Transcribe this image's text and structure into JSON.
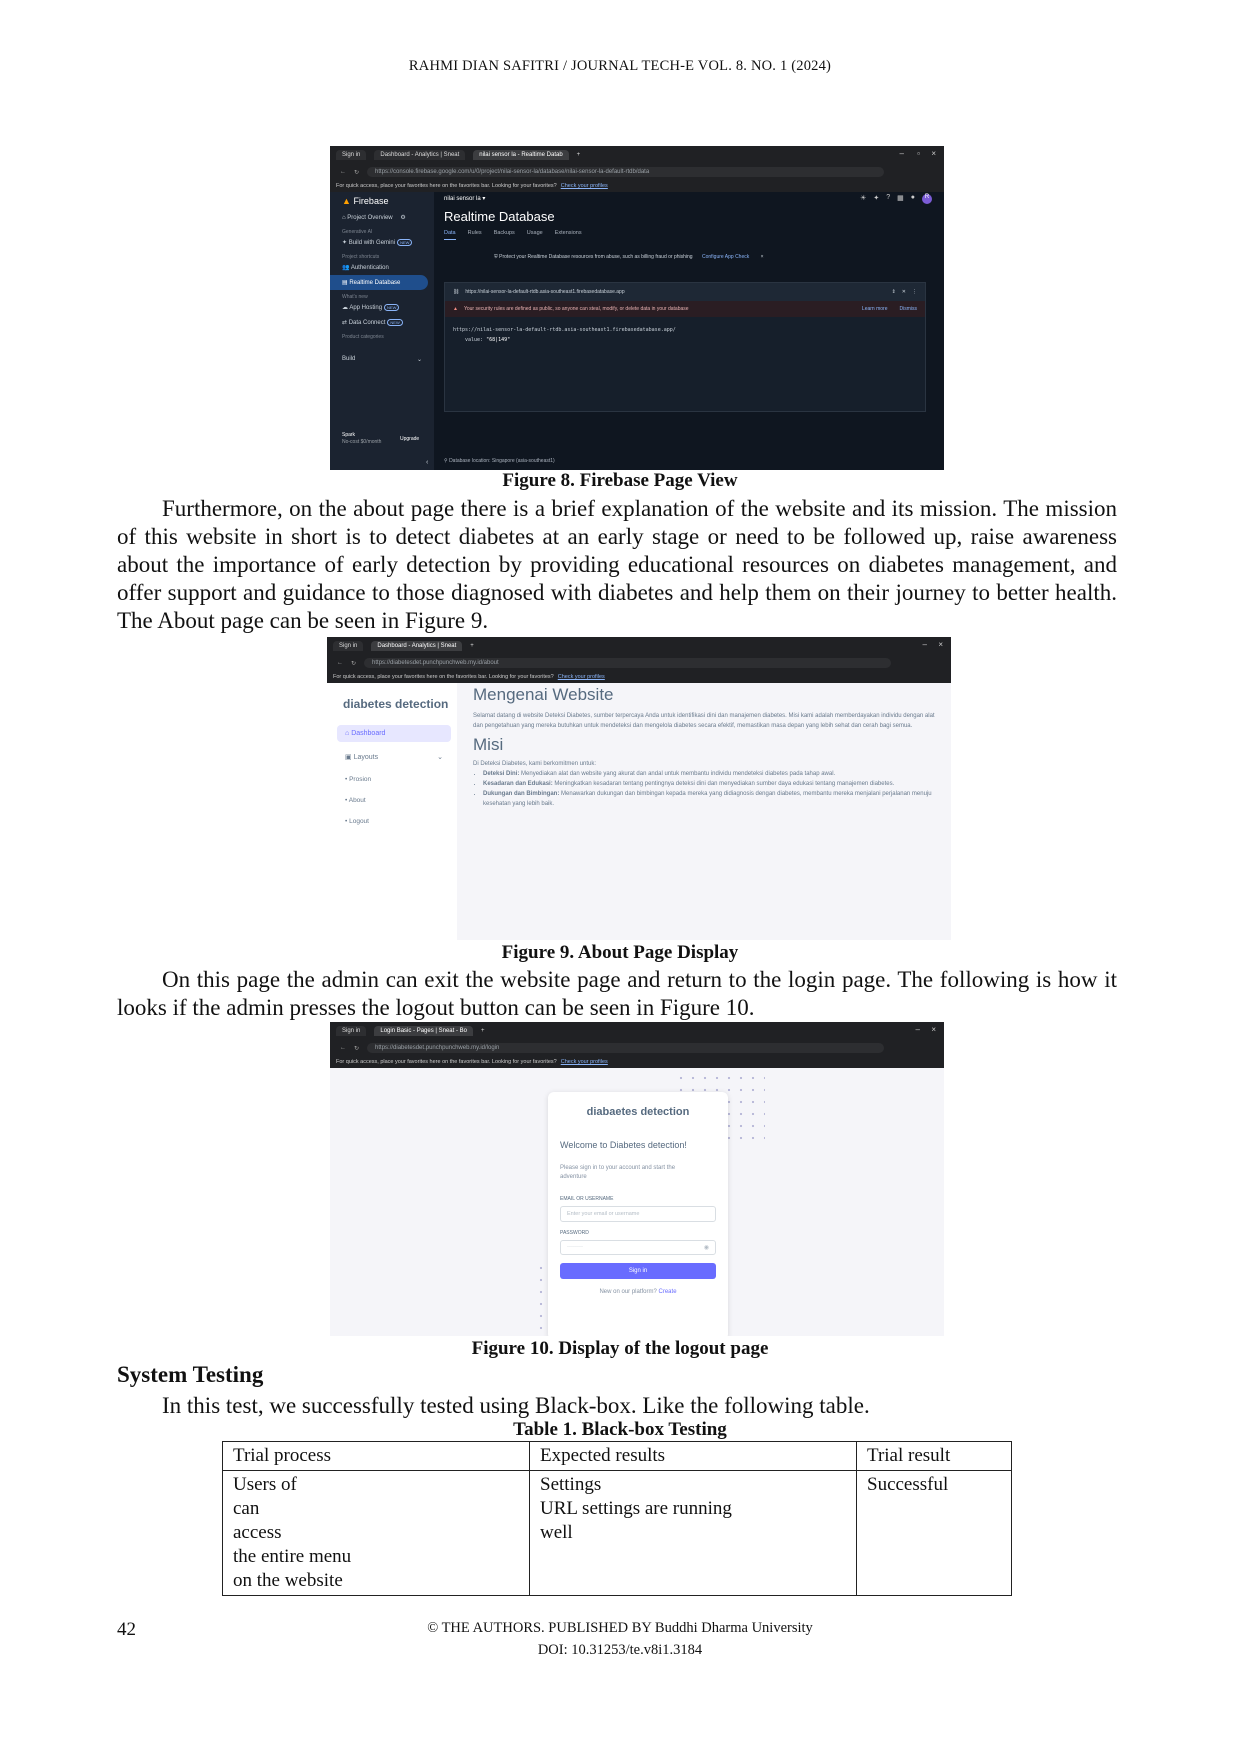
{
  "header": {
    "running_head": "RAHMI DIAN SAFITRI / JOURNAL TECH-E VOL. 8. NO. 1 (2024)"
  },
  "figure8": {
    "caption": "Figure 8. Firebase Page View",
    "tabs": [
      "Sign in",
      "Dashboard - Analytics | Sneat",
      "nilai sensor la - Realtime Datab"
    ],
    "url": "https://console.firebase.google.com/u/0/project/nilai-sensor-la/database/nilai-sensor-la-default-rtdb/data",
    "favbar_text": "For quick access, place your favorites here on the favorites bar. Looking for your favorites?",
    "favbar_link": "Check your profiles",
    "brand": "Firebase",
    "project": "nilai sensor la",
    "sidebar": {
      "overview": "Project Overview",
      "cat_genai": "Generative AI",
      "gemini": "Build with Gemini",
      "cat_shortcuts": "Project shortcuts",
      "auth": "Authentication",
      "rtdb": "Realtime Database",
      "cat_new": "What's new",
      "hosting": "App Hosting",
      "dataconnect": "Data Connect",
      "cat_product": "Product categories",
      "build": "Build",
      "plan": "Spark",
      "plan_sub": "No-cost $0/month",
      "upgrade": "Upgrade",
      "new_badge": "NEW"
    },
    "page_title": "Realtime Database",
    "tabs_main": [
      "Data",
      "Rules",
      "Backups",
      "Usage",
      "Extensions"
    ],
    "protect_text": "Protect your Realtime Database resources from abuse, such as billing fraud or phishing",
    "protect_link": "Configure App Check",
    "db_url": "https://nilai-sensor-la-default-rtdb.asia-southeast1.firebasedatabase.app",
    "warning": "Your security rules are defined as public, so anyone can steal, modify, or delete data in your database",
    "learn_more": "Learn more",
    "dismiss": "Dismiss",
    "tree_root": "https://nilai-sensor-la-default-rtdb.asia-southeast1.firebasedatabase.app/",
    "tree_key": "value:",
    "tree_value": "\"68|149\"",
    "location": "Database location: Singapore (asia-southeast1)"
  },
  "para1": "Furthermore, on the about page there is a brief explanation of the website and its mission. The mission of this website in short is to detect diabetes at an early stage or need to be followed up, raise awareness about the importance of early detection by providing educational resources on diabetes management, and offer support and guidance to those diagnosed with diabetes and help them on their journey to better health. The About page can be seen in Figure 9.",
  "figure9": {
    "caption": "Figure 9. About Page Display",
    "tabs": [
      "Sign in",
      "Dashboard - Analytics | Sneat"
    ],
    "url": "https://diabetesdet.punchpunchweb.my.id/about",
    "favbar_text": "For quick access, place your favorites here on the favorites bar. Looking for your favorites?",
    "favbar_link": "Check your profiles",
    "brand": "diabetes detection",
    "menu": [
      "Dashboard",
      "Layouts",
      "Prosion",
      "About",
      "Logout"
    ],
    "heading1": "Mengenai Website",
    "intro": "Selamat datang di website Deteksi Diabetes, sumber terpercaya Anda untuk identifikasi dini dan manajemen diabetes. Misi kami adalah memberdayakan individu dengan alat dan pengetahuan yang mereka butuhkan untuk mendeteksi dan mengelola diabetes secara efektif, memastikan masa depan yang lebih sehat dan cerah bagi semua.",
    "heading2": "Misi",
    "misi_intro": "Di Deteksi Diabetes, kami berkomitmen untuk:",
    "items": [
      {
        "b": "Deteksi Dini:",
        "t": "Menyediakan alat dan website yang akurat dan andal untuk membantu individu mendeteksi diabetes pada tahap awal."
      },
      {
        "b": "Kesadaran dan Edukasi:",
        "t": "Meningkatkan kesadaran tentang pentingnya deteksi dini dan menyediakan sumber daya edukasi tentang manajemen diabetes."
      },
      {
        "b": "Dukungan dan Bimbingan:",
        "t": "Menawarkan dukungan dan bimbingan kepada mereka yang didiagnosis dengan diabetes, membantu mereka menjalani perjalanan menuju kesehatan yang lebih baik."
      }
    ]
  },
  "para2": "On this page the admin can exit the website page and return to the login page. The following is how it looks if the admin presses the logout button can be seen in Figure 10.",
  "figure10": {
    "caption": "Figure 10. Display of the logout page",
    "tabs": [
      "Sign in",
      "Login Basic - Pages | Sneat - Bo"
    ],
    "url": "https://diabetesdet.punchpunchweb.my.id/login",
    "favbar_text": "For quick access, place your favorites here on the favorites bar. Looking for your favorites?",
    "favbar_link": "Check your profiles",
    "brand": "diabaetes detection",
    "welcome": "Welcome to Diabetes detection!",
    "sub": "Please sign in to your account and start the adventure",
    "email_label": "EMAIL OR USERNAME",
    "email_placeholder": "Enter your email or username",
    "password_label": "PASSWORD",
    "password_placeholder": "········",
    "signin": "Sign in",
    "new_text": "New on our platform?",
    "create": "Create"
  },
  "section_title": "System Testing",
  "para3": "In this test, we successfully tested using Black-box. Like the following table.",
  "table": {
    "caption": "Table 1. Black-box Testing",
    "headers": [
      "Trial process",
      "Expected results",
      "Trial result"
    ],
    "row": {
      "c1": [
        "Users of",
        "can",
        "access",
        "the entire menu",
        "on the website"
      ],
      "c2": [
        "Settings",
        "URL settings are running",
        "well"
      ],
      "c3": [
        "Successful"
      ]
    }
  },
  "footer": {
    "page_number": "42",
    "line1": "© THE AUTHORS. PUBLISHED BY Buddhi Dharma University",
    "line2": "DOI: 10.31253/te.v8i1.3184"
  }
}
